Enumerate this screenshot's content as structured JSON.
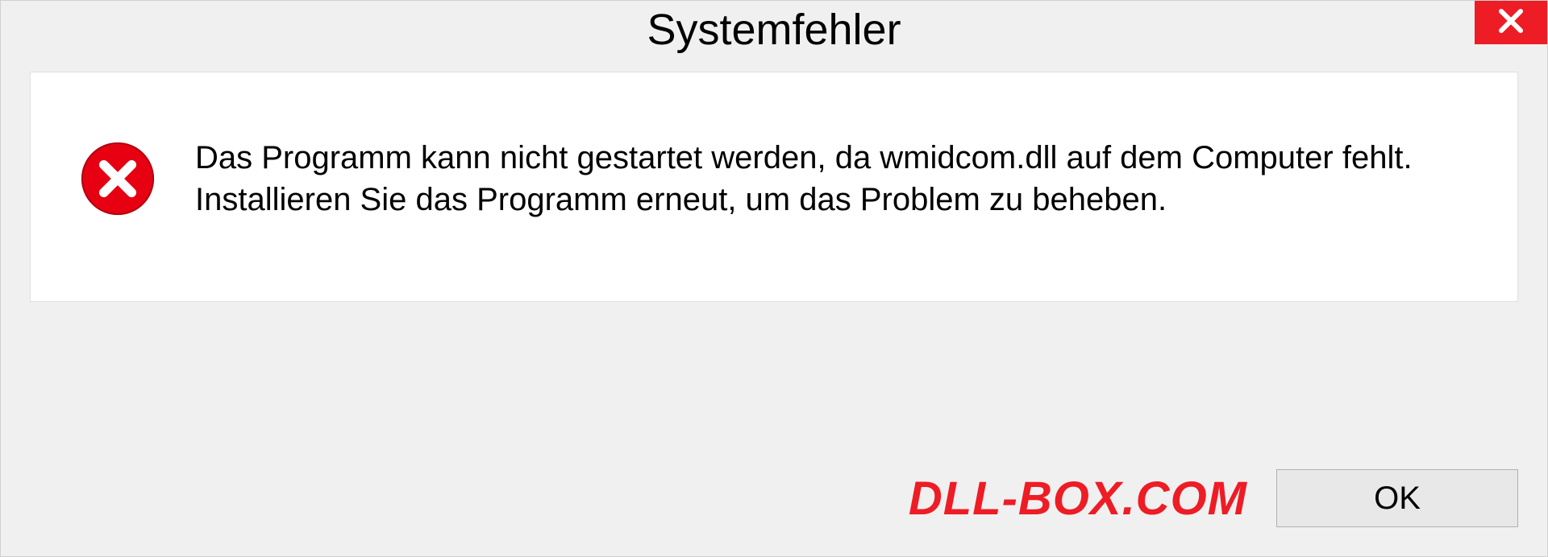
{
  "dialog": {
    "title": "Systemfehler",
    "message": "Das Programm kann nicht gestartet werden, da wmidcom.dll auf dem Computer fehlt. Installieren Sie das Programm erneut, um das Problem zu beheben.",
    "ok_label": "OK"
  },
  "watermark": {
    "text": "DLL-BOX.COM"
  }
}
